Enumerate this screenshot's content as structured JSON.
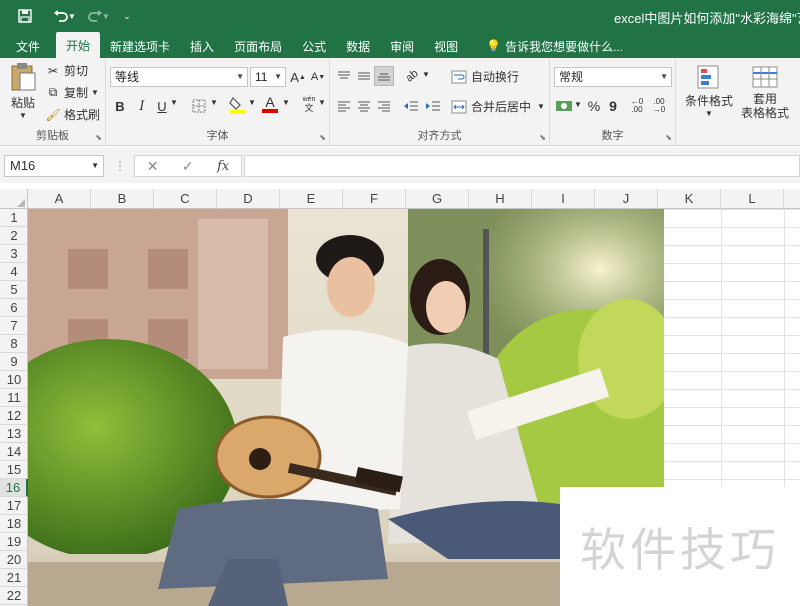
{
  "window": {
    "title": "excel中图片如何添加\"水彩海绵\"艺术",
    "accent_color": "#217346"
  },
  "qat": {
    "save_icon": "save-icon",
    "undo_icon": "undo-icon",
    "redo_icon": "redo-icon",
    "customize_icon": "customize-qat-icon"
  },
  "tabs": {
    "file": "文件",
    "home": "开始",
    "insert_new": "新建选项卡",
    "insert": "插入",
    "page_layout": "页面布局",
    "formulas": "公式",
    "data": "数据",
    "review": "审阅",
    "view": "视图",
    "tell_me": "告诉我您想要做什么..."
  },
  "clipboard": {
    "paste": "粘贴",
    "cut": "剪切",
    "copy": "复制",
    "format_painter": "格式刷",
    "group_label": "剪贴板"
  },
  "font": {
    "name": "等线",
    "size": "11",
    "bold": "B",
    "italic": "I",
    "underline": "U",
    "font_color_letter": "A",
    "group_label": "字体"
  },
  "alignment": {
    "wrap_text": "自动换行",
    "merge_center": "合并后居中",
    "group_label": "对齐方式"
  },
  "number": {
    "format": "常规",
    "percent": "%",
    "comma": "9",
    "group_label": "数字"
  },
  "styles": {
    "conditional_formatting": "条件格式",
    "format_as_table": "套用\n表格格式"
  },
  "formula_bar": {
    "name_box": "M16",
    "cancel": "✕",
    "enter": "✓",
    "fx": "fx",
    "content": ""
  },
  "sheet": {
    "columns": [
      "A",
      "B",
      "C",
      "D",
      "E",
      "F",
      "G",
      "H",
      "I",
      "J",
      "K",
      "L"
    ],
    "rows": [
      "1",
      "2",
      "3",
      "4",
      "5",
      "6",
      "7",
      "8",
      "9",
      "10",
      "11",
      "12",
      "13",
      "14",
      "15",
      "16",
      "17",
      "18",
      "19",
      "20",
      "21",
      "22"
    ],
    "selected_row": "16"
  },
  "watermark": {
    "text": "软件技巧"
  }
}
